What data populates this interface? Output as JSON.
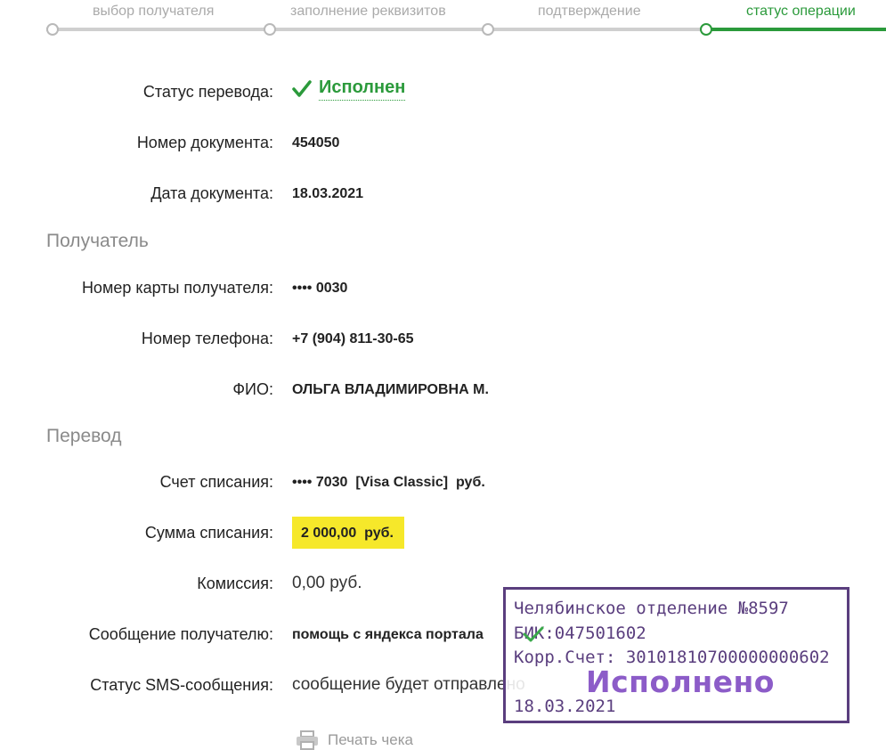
{
  "steps": [
    {
      "label": "выбор получателя"
    },
    {
      "label": "заполнение реквизитов"
    },
    {
      "label": "подтверждение"
    },
    {
      "label": "статус операции"
    }
  ],
  "fields": {
    "status_label": "Статус перевода:",
    "status_value": "Исполнен",
    "doc_number_label": "Номер документа:",
    "doc_number_value": "454050",
    "doc_date_label": "Дата документа:",
    "doc_date_value": "18.03.2021"
  },
  "recipient": {
    "heading": "Получатель",
    "card_label": "Номер карты получателя:",
    "card_value": "•••• 0030",
    "phone_label": "Номер телефона:",
    "phone_value": "+7 (904) 811-30-65",
    "name_label": "ФИО:",
    "name_value": "ОЛЬГА ВЛАДИМИРОВНА М."
  },
  "transfer": {
    "heading": "Перевод",
    "account_label": "Счет списания:",
    "account_value": "•••• 7030  [Visa Classic]  руб.",
    "amount_label": "Сумма списания:",
    "amount_value": "2 000,00  руб.",
    "fee_label": "Комиссия:",
    "fee_value": "0,00 руб.",
    "message_label": "Сообщение получателю:",
    "message_value": "помощь с яндекса портала",
    "sms_label": "Статус SMS-сообщения:",
    "sms_value": "сообщение будет отправлено"
  },
  "stamp": {
    "line1": "Челябинское отделение №8597",
    "line2": "БИК:047501602",
    "line3": "Корр.Счет: 30101810700000000602",
    "big": "Исполнено",
    "date": "18.03.2021"
  },
  "print": {
    "label": "Печать чека"
  },
  "colors": {
    "accent": "#2b9a3b",
    "highlight": "#f6e82a",
    "stamp": "#5a3e7e"
  }
}
